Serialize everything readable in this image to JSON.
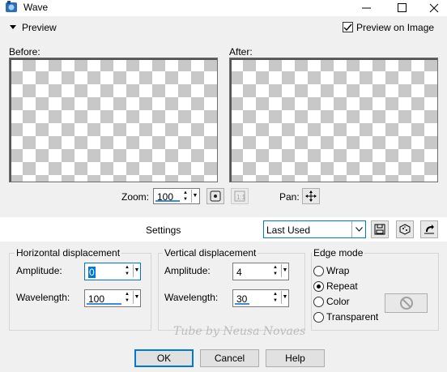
{
  "window": {
    "title": "Wave",
    "close": "✕",
    "maximize": "☐",
    "minimize": "—"
  },
  "preview": {
    "toggle_label": "Preview",
    "preview_on_image_label": "Preview on Image",
    "preview_on_image_checked": true
  },
  "panes": {
    "before_label": "Before:",
    "after_label": "After:"
  },
  "zoom": {
    "label": "Zoom:",
    "value": "100",
    "pan_label": "Pan:"
  },
  "settings": {
    "label": "Settings",
    "preset_value": "Last Used"
  },
  "horizontal": {
    "title": "Horizontal displacement",
    "amplitude_label": "Amplitude:",
    "amplitude_value": "0",
    "wavelength_label": "Wavelength:",
    "wavelength_value": "100"
  },
  "vertical": {
    "title": "Vertical displacement",
    "amplitude_label": "Amplitude:",
    "amplitude_value": "4",
    "wavelength_label": "Wavelength:",
    "wavelength_value": "30"
  },
  "edge_mode": {
    "title": "Edge mode",
    "options": [
      "Wrap",
      "Repeat",
      "Color",
      "Transparent"
    ],
    "selected": "Repeat"
  },
  "buttons": {
    "ok": "OK",
    "cancel": "Cancel",
    "help": "Help"
  },
  "watermark": "Tube by Neusa Novaes"
}
